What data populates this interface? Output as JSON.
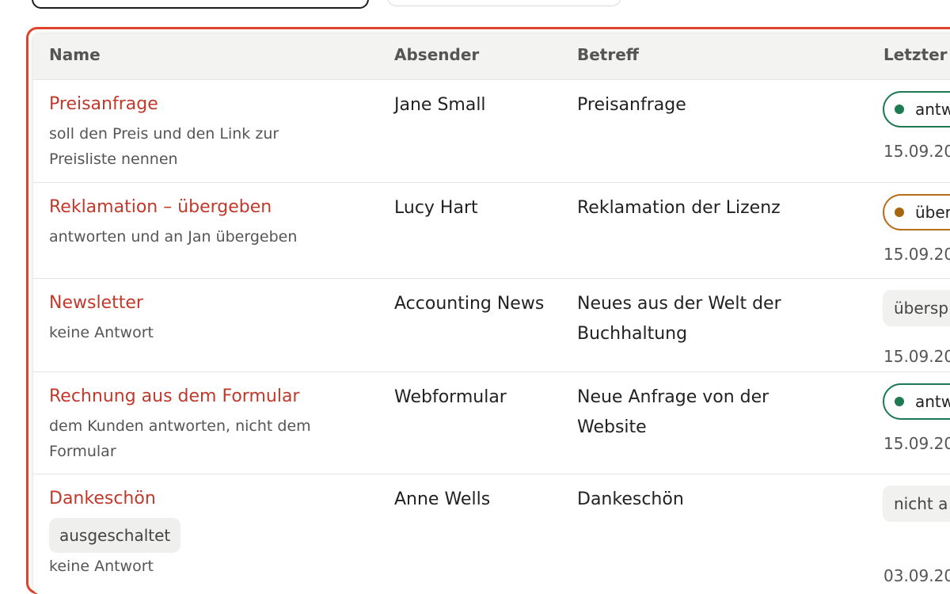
{
  "table": {
    "headers": {
      "name": "Name",
      "sender": "Absender",
      "subject": "Betreff",
      "last": "Letzter l"
    },
    "rows": [
      {
        "name": "Preisanfrage",
        "description": "soll den Preis und den Link zur Preisliste nennen",
        "sender": "Jane Small",
        "subject": "Preisanfrage",
        "status": "antw",
        "status_color": "#1e7a52",
        "date": "15.09.20"
      },
      {
        "name": "Reklamation – übergeben",
        "description": "antworten und an Jan übergeben",
        "sender": "Lucy Hart",
        "subject": "Reklamation der Lizenz",
        "status": "über",
        "status_color": "#b86d1a",
        "date": "15.09.20"
      },
      {
        "name": "Newsletter",
        "description": "keine Antwort",
        "sender": "Accounting News",
        "subject": "Neues aus der Welt der Buchhaltung",
        "status": "übersp",
        "status_color": "#f1f1ef",
        "date": "15.09.20"
      },
      {
        "name": "Rechnung aus dem Formular",
        "description": "dem Kunden antworten, nicht dem Formular",
        "sender": "Webformular",
        "subject": "Neue Anfrage von der Website",
        "status": "antw",
        "status_color": "#1e7a52",
        "date": "15.09.20"
      },
      {
        "name": "Dankeschön",
        "tag": "ausgeschaltet",
        "description": "keine Antwort",
        "sender": "Anne Wells",
        "subject": "Dankeschön",
        "status": "nicht a",
        "status_color": "#f1f1ef",
        "date": "03.09.20"
      }
    ]
  },
  "colors": {
    "highlight": "#e0432b",
    "name_link": "#c0392b"
  }
}
